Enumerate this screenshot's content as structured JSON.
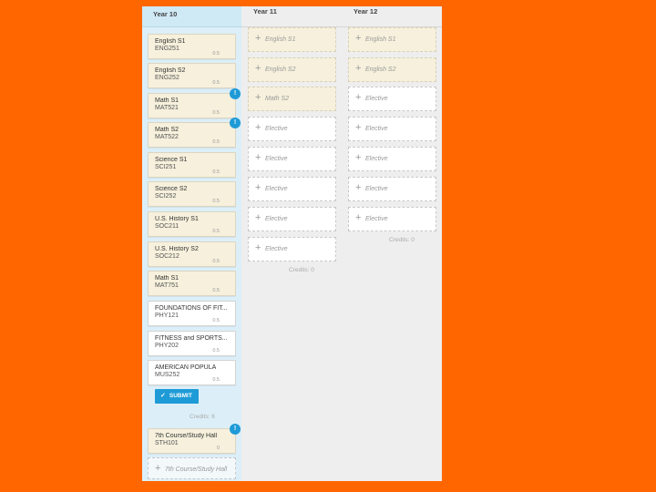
{
  "columns": {
    "year10": {
      "title": "Year 10",
      "courses": [
        {
          "name": "English S1",
          "code": "ENG251",
          "credits": "0.5",
          "badge": ""
        },
        {
          "name": "English S2",
          "code": "ENG252",
          "credits": "0.5",
          "badge": ""
        },
        {
          "name": "Math S1",
          "code": "MAT521",
          "credits": "0.5",
          "badge": "!"
        },
        {
          "name": "Math S2",
          "code": "MAT522",
          "credits": "0.5",
          "badge": "!"
        },
        {
          "name": "Science S1",
          "code": "SCI251",
          "credits": "0.5",
          "badge": ""
        },
        {
          "name": "Science S2",
          "code": "SCI252",
          "credits": "0.5",
          "badge": ""
        },
        {
          "name": "U.S. History S1",
          "code": "SOC211",
          "credits": "0.5",
          "badge": ""
        },
        {
          "name": "U.S. History S2",
          "code": "SOC212",
          "credits": "0.5",
          "badge": ""
        },
        {
          "name": "Math S1",
          "code": "MAT751",
          "credits": "0.5",
          "badge": ""
        },
        {
          "name": "FOUNDATIONS OF FIT...",
          "code": "PHY121",
          "credits": "0.5",
          "badge": ""
        },
        {
          "name": "FITNESS and SPORTS...",
          "code": "PHY202",
          "credits": "0.5",
          "badge": ""
        },
        {
          "name": "AMERICAN POPULA",
          "code": "MUS252",
          "credits": "0.5",
          "badge": ""
        }
      ],
      "submit_label": "SUBMIT",
      "credits_label": "Credits: 6",
      "study_hall": {
        "name": "7th Course/Study Hall",
        "code": "STH101",
        "credits": "0",
        "badge": "!"
      },
      "study_hall_slot": "7th Course/Study Hall"
    },
    "year11": {
      "title": "Year 11",
      "slots": [
        {
          "label": "English S1",
          "filled": true
        },
        {
          "label": "English S2",
          "filled": true
        },
        {
          "label": "Math S2",
          "filled": true
        },
        {
          "label": "Elective",
          "filled": false
        },
        {
          "label": "Elective",
          "filled": false
        },
        {
          "label": "Elective",
          "filled": false
        },
        {
          "label": "Elective",
          "filled": false
        },
        {
          "label": "Elective",
          "filled": false
        }
      ],
      "credits_label": "Credits: 0"
    },
    "year12": {
      "title": "Year 12",
      "slots": [
        {
          "label": "English S1",
          "filled": true
        },
        {
          "label": "English S2",
          "filled": true
        },
        {
          "label": "Elective",
          "filled": false
        },
        {
          "label": "Elective",
          "filled": false
        },
        {
          "label": "Elective",
          "filled": false
        },
        {
          "label": "Elective",
          "filled": false
        },
        {
          "label": "Elective",
          "filled": false
        }
      ],
      "credits_label": "Credits: 0"
    }
  },
  "icons": {
    "plus": "+",
    "check": "✓"
  },
  "colors": {
    "accent": "#1E9BD7",
    "background": "#FF6600",
    "course_card": "#F6F0DC"
  }
}
